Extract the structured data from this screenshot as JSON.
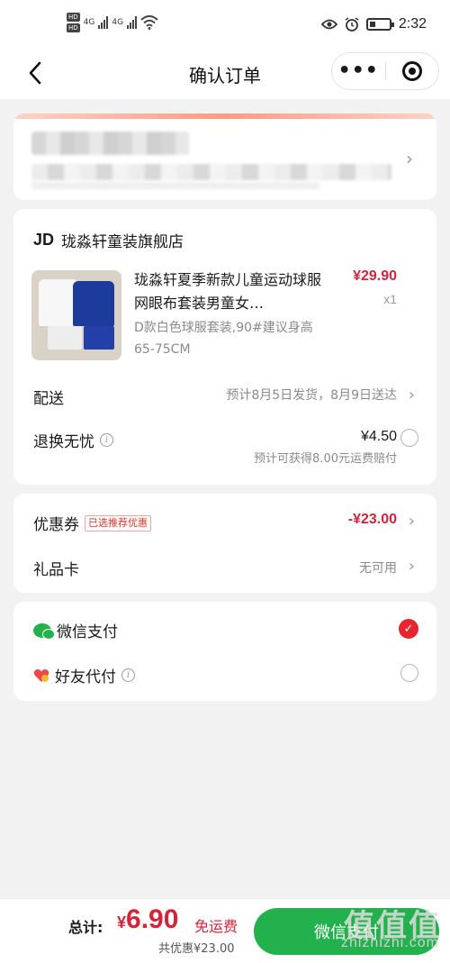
{
  "status_bar": {
    "hd1": "HD",
    "hd2": "HD",
    "net1": "4G",
    "net2": "4G",
    "time": "2:32"
  },
  "nav": {
    "back_icon": "chevron-left-icon",
    "title": "确认订单",
    "more_icon": "more-dots-icon",
    "more_label": "•••",
    "target_icon": "target-icon"
  },
  "shop": {
    "logo": "JD",
    "name": "珑淼轩童装旗舰店",
    "product": {
      "name": "珑淼轩夏季新款儿童运动球服网眼布套装男童女…",
      "price": "¥29.90",
      "qty": "x1",
      "spec": "D款白色球服套装,90#建议身高65-75CM"
    },
    "shipping": {
      "label": "配送",
      "value": "预计8月5日发货，8月9日送达"
    },
    "return": {
      "label": "退换无忧",
      "info": "i",
      "price": "¥4.50",
      "note": "预计可获得8.00元运费赔付"
    }
  },
  "coupon": {
    "label": "优惠券",
    "tag": "已选推荐优惠",
    "value": "-¥23.00"
  },
  "gift_card": {
    "label": "礼品卡",
    "value": "无可用"
  },
  "payment": {
    "wechat": {
      "label": "微信支付",
      "icon": "wechat-icon",
      "selected": true
    },
    "friend": {
      "label": "好友代付",
      "info": "i",
      "icon": "heart-icon",
      "selected": false
    }
  },
  "bottom": {
    "total_label": "总计:",
    "currency": "¥",
    "total": "6.90",
    "free_shipping": "免运费",
    "discount": "共优惠¥23.00",
    "pay_button": "微信支付",
    "watermark": "值值值",
    "watermark_url": "zhizhizhi.com"
  },
  "colors": {
    "accent": "#d4233b",
    "wechat_green": "#22b14c",
    "check_red": "#e5262f"
  }
}
